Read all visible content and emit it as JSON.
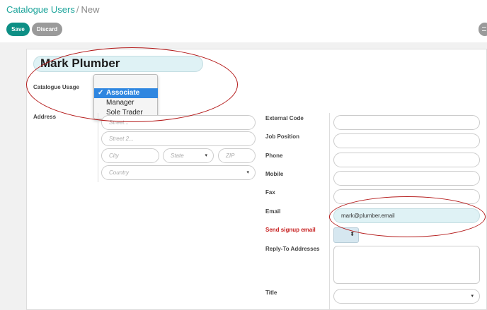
{
  "breadcrumb": {
    "parent": "Catalogue Users",
    "separator": "/",
    "current": "New"
  },
  "toolbar": {
    "save_label": "Save",
    "discard_label": "Discard"
  },
  "record": {
    "name": "Mark Plumber"
  },
  "catalogue_usage": {
    "label": "Catalogue Usage",
    "options": [
      "Associate",
      "Manager",
      "Sole Trader"
    ],
    "selected": "Associate",
    "check_glyph": "✓"
  },
  "address": {
    "label": "Address",
    "street_placeholder": "Street...",
    "street2_placeholder": "Street 2...",
    "city_placeholder": "City",
    "state_placeholder": "State",
    "zip_placeholder": "ZIP",
    "country_placeholder": "Country"
  },
  "fields": {
    "external_code": "External Code",
    "job_position": "Job Position",
    "phone": "Phone",
    "mobile": "Mobile",
    "fax": "Fax",
    "email": "Email",
    "email_value": "mark@plumber.email",
    "send_signup_email": "Send signup email",
    "reply_to": "Reply-To Addresses",
    "title": "Title"
  },
  "icons": {
    "caret": "▾",
    "spinner": "⬍"
  },
  "colors": {
    "accent": "#0d8f85",
    "highlight": "#dff2f5",
    "annotation": "#b51c1c",
    "required": "#c72020"
  }
}
